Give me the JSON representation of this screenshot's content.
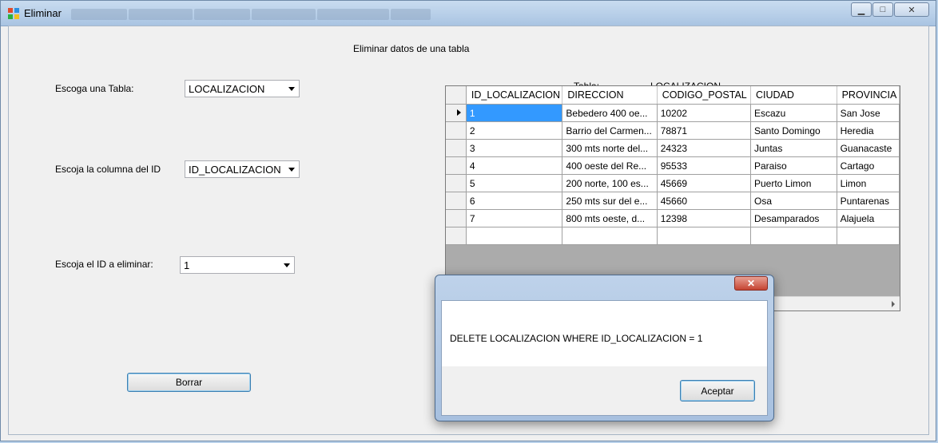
{
  "window": {
    "title": "Eliminar"
  },
  "form": {
    "heading": "Eliminar datos de una tabla",
    "table_label": "Escoga una Tabla:",
    "table_value": "LOCALIZACION",
    "column_label": "Escoja la columna del ID",
    "column_value": "ID_LOCALIZACION",
    "id_label": "Escoja el  ID a eliminar:",
    "id_value": "1",
    "delete_button": "Borrar",
    "tabla_caption": "Tabla:",
    "tabla_name": "LOCALIZACION"
  },
  "grid": {
    "columns": [
      "ID_LOCALIZACION",
      "DIRECCION",
      "CODIGO_POSTAL",
      "CIUDAD",
      "PROVINCIA"
    ],
    "rows": [
      [
        "1",
        "Bebedero 400 oe...",
        "10202",
        "Escazu",
        "San Jose"
      ],
      [
        "2",
        "Barrio del Carmen...",
        "78871",
        "Santo Domingo",
        "Heredia"
      ],
      [
        "3",
        "300 mts norte del...",
        "24323",
        "Juntas",
        "Guanacaste"
      ],
      [
        "4",
        "400 oeste del Re...",
        "95533",
        "Paraiso",
        "Cartago"
      ],
      [
        "5",
        "200 norte, 100 es...",
        "45669",
        "Puerto Limon",
        "Limon"
      ],
      [
        "6",
        "250 mts sur del e...",
        "45660",
        "Osa",
        "Puntarenas"
      ],
      [
        "7",
        "800 mts oeste, d...",
        "12398",
        "Desamparados",
        "Alajuela"
      ]
    ]
  },
  "dialog": {
    "message": "DELETE LOCALIZACION WHERE ID_LOCALIZACION = 1",
    "ok_button": "Aceptar"
  },
  "colors": {
    "selection": "#3399ff",
    "close_button": "#c54432"
  }
}
